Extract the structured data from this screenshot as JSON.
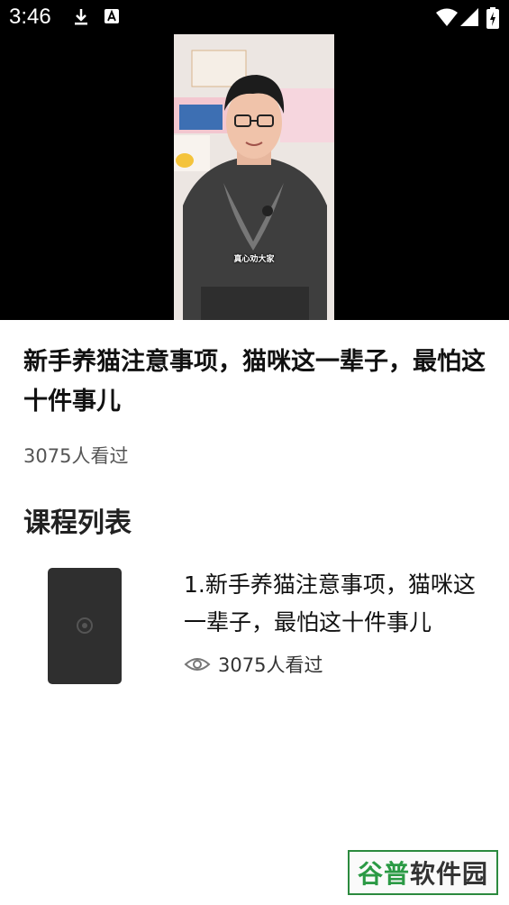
{
  "status_bar": {
    "time": "3:46",
    "icons": [
      "download-icon",
      "notification-a-icon",
      "wifi-icon",
      "signal-icon",
      "battery-icon"
    ]
  },
  "video": {
    "subtitle": "真心劝大家"
  },
  "course": {
    "title": "新手养猫注意事项，猫咪这一辈子，最怕这十件事儿",
    "views": "3075人看过"
  },
  "section_title": "课程列表",
  "list": [
    {
      "title": "1.新手养猫注意事项，猫咪这一辈子，最怕这十件事儿",
      "views": "3075人看过",
      "icon": "eye-icon"
    }
  ],
  "watermark": {
    "part1": "谷普",
    "part2": "软件园"
  },
  "colors": {
    "status_bar_bg": "#000000",
    "watermark_green": "#2b9a45"
  }
}
